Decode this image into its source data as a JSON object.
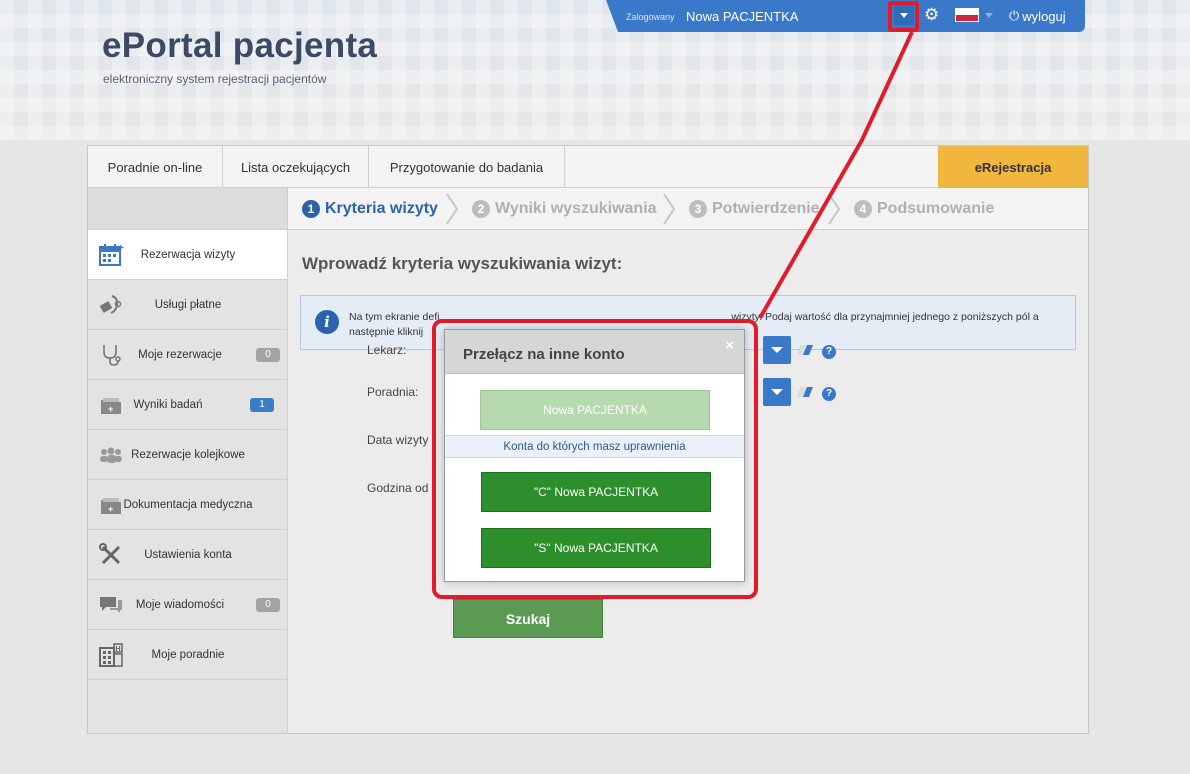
{
  "brand": {
    "title": "ePortal pacjenta",
    "subtitle": "elektroniczny system rejestracji pacjentów"
  },
  "topbar": {
    "logged_label": "Zalogowany",
    "user_name": "Nowa PACJENTKA",
    "logout_label": "wyloguj",
    "icons": [
      "chevron-down-icon",
      "gear-icon",
      "flag-pl-icon",
      "power-icon"
    ]
  },
  "tabs": {
    "items": [
      "Poradnie on-line",
      "Lista oczekujących",
      "Przygotowanie do badania"
    ],
    "active": "eRejestracja"
  },
  "sidebar": {
    "items": [
      {
        "label": "Rezerwacja wizyty",
        "icon": "calendar-icon",
        "badge": ""
      },
      {
        "label": "Usługi płatne",
        "icon": "stethoscope-tag-icon",
        "badge": ""
      },
      {
        "label": "Moje rezerwacje",
        "icon": "stethoscope-icon",
        "badge": "0"
      },
      {
        "label": "Wyniki badań",
        "icon": "folder-plus-icon",
        "badge": "1"
      },
      {
        "label": "Rezerwacje kolejkowe",
        "icon": "people-icon",
        "badge": ""
      },
      {
        "label": "Dokumentacja medyczna",
        "icon": "folder-plus-icon",
        "badge": ""
      },
      {
        "label": "Ustawienia konta",
        "icon": "tools-icon",
        "badge": ""
      },
      {
        "label": "Moje wiadomości",
        "icon": "chat-icon",
        "badge": "0"
      },
      {
        "label": "Moje poradnie",
        "icon": "hospital-icon",
        "badge": ""
      }
    ]
  },
  "steps": [
    {
      "num": "1",
      "label": "Kryteria wizyty"
    },
    {
      "num": "2",
      "label": "Wyniki wyszukiwania"
    },
    {
      "num": "3",
      "label": "Potwierdzenie"
    },
    {
      "num": "4",
      "label": "Podsumowanie"
    }
  ],
  "form": {
    "title": "Wprowadź kryteria wyszukiwania wizyt:",
    "info_line1_left": "Na tym ekranie defi",
    "info_line1_right": "wizyty. Podaj wartość dla przynajmniej jednego z poniższych pól a",
    "info_line2": "następnie kliknij",
    "labels": {
      "doctor": "Lekarz:",
      "clinic": "Poradnia:",
      "date": "Data wizyty",
      "time": "Godzina od"
    },
    "search_button": "Szukaj"
  },
  "modal": {
    "title": "Przełącz na inne konto",
    "close": "×",
    "current_account": "Nowa PACJENTKA",
    "section_label": "Konta do których masz uprawnienia",
    "accounts": [
      "\"C\" Nowa PACJENTKA",
      "\"S\" Nowa PACJENTKA"
    ]
  },
  "colors": {
    "accent_blue": "#3a78c9",
    "tab_active": "#f0b63e",
    "highlight_red": "#e01b2a",
    "account_green": "#2d8f2b"
  }
}
